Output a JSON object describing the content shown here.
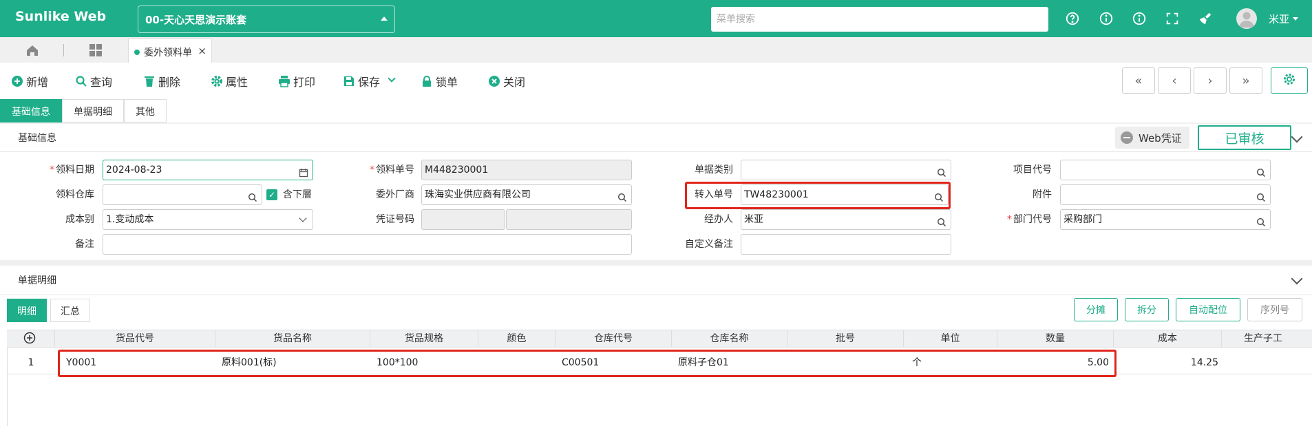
{
  "app": {
    "logo": "Sunlike Web",
    "account": "00-天心天思演示账套",
    "menu_search_placeholder": "菜单搜索",
    "username": "米亚"
  },
  "tabs": {
    "doc_tab": "委外领料单",
    "close": "×"
  },
  "toolbar": {
    "add": "新增",
    "query": "查询",
    "delete": "删除",
    "properties": "属性",
    "print": "打印",
    "save": "保存",
    "lock": "锁单",
    "close": "关闭"
  },
  "nav": {
    "first": "«",
    "prev": "‹",
    "next": "›",
    "last": "»"
  },
  "section_tabs": [
    "基础信息",
    "单据明细",
    "其他"
  ],
  "basic": {
    "title": "基础信息",
    "web_voucher": "Web凭证",
    "status": "已审核"
  },
  "form": {
    "req_mark": "*",
    "date_label": "领料日期",
    "date_value": "2024-08-23",
    "doc_no_label": "领料单号",
    "doc_no_value": "M448230001",
    "doc_type_label": "单据类别",
    "doc_type_value": "",
    "project_label": "项目代号",
    "project_value": "",
    "warehouse_label": "领料仓库",
    "warehouse_value": "",
    "include_sub_label": "含下層",
    "vendor_label": "委外厂商",
    "vendor_value": "珠海实业供应商有限公司",
    "transfer_label": "转入单号",
    "transfer_value": "TW48230001",
    "attach_label": "附件",
    "attach_value": "",
    "cost_label": "成本别",
    "cost_value": "1.变动成本",
    "voucher_label": "凭证号码",
    "handler_label": "经办人",
    "handler_value": "米亚",
    "dept_label": "部门代号",
    "dept_value": "采购部门",
    "remark_label": "备注",
    "remark_value": "",
    "custom_label": "自定义备注",
    "custom_value": ""
  },
  "detail": {
    "title": "单据明细",
    "tabs": [
      "明细",
      "汇总"
    ],
    "buttons": [
      "分摊",
      "拆分",
      "自动配位",
      "序列号"
    ],
    "columns": [
      "货品代号",
      "货品名称",
      "货品规格",
      "颜色",
      "仓库代号",
      "仓库名称",
      "批号",
      "单位",
      "数量",
      "成本",
      "生产子工"
    ],
    "rows": [
      {
        "no": "1",
        "item_code": "Y0001",
        "item_name": "原料001(标)",
        "spec": "100*100",
        "color": "",
        "wh_code": "C00501",
        "wh_name": "原料子仓01",
        "batch": "",
        "unit": "个",
        "qty": "5.00",
        "cost": "14.25"
      }
    ]
  },
  "colors": {
    "accent": "#1fae8a",
    "highlight": "#e1251b"
  }
}
